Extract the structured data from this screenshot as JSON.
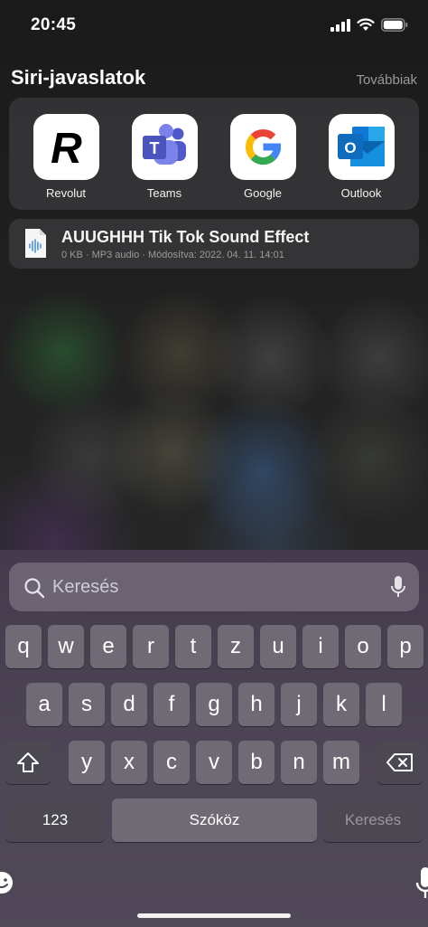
{
  "status": {
    "time": "20:45",
    "icons": [
      "cellular-signal-icon",
      "wifi-icon",
      "battery-icon"
    ]
  },
  "siri": {
    "title": "Siri-javaslatok",
    "more_label": "Továbbiak",
    "apps": [
      {
        "label": "Revolut",
        "icon": "revolut-icon"
      },
      {
        "label": "Teams",
        "icon": "teams-icon"
      },
      {
        "label": "Google",
        "icon": "google-icon"
      },
      {
        "label": "Outlook",
        "icon": "outlook-icon"
      }
    ]
  },
  "file_result": {
    "title": "AUUGHHH Tik Tok Sound Effect",
    "meta": "0 KB · MP3 audio · Módosítva: 2022. 04. 11. 14:01",
    "icon": "audio-file-icon"
  },
  "search": {
    "placeholder": "Keresés",
    "value": ""
  },
  "keyboard": {
    "row1": [
      "q",
      "w",
      "e",
      "r",
      "t",
      "z",
      "u",
      "i",
      "o",
      "p"
    ],
    "row2": [
      "a",
      "s",
      "d",
      "f",
      "g",
      "h",
      "j",
      "k",
      "l"
    ],
    "row3": [
      "y",
      "x",
      "c",
      "v",
      "b",
      "n",
      "m"
    ],
    "numbers_label": "123",
    "space_label": "Szóköz",
    "search_label": "Keresés"
  },
  "colors": {
    "revolut": "#000000",
    "teams": "#5059C9",
    "outlook": "#0F6CBD",
    "key": "#6f6a74",
    "key_dark": "#4c4852"
  }
}
